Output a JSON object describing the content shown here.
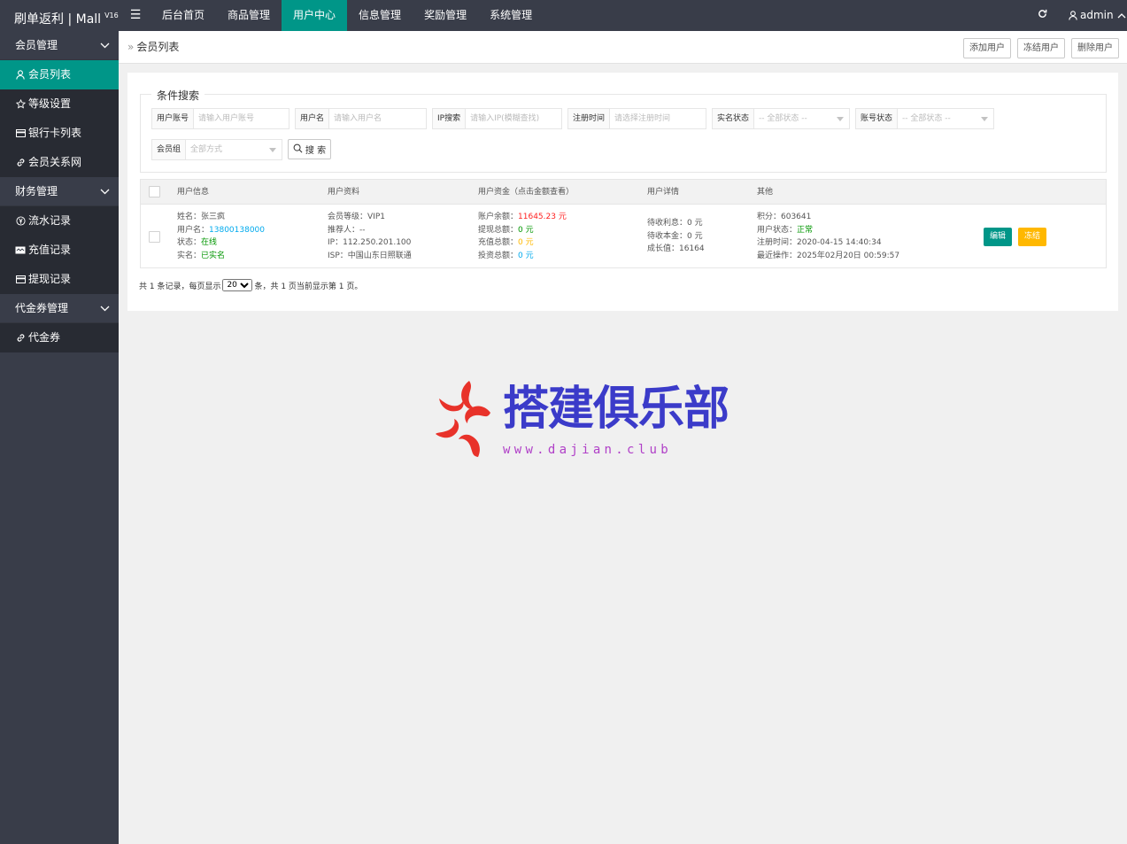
{
  "app": {
    "title": "刷单返利 | Mall",
    "version": "V16"
  },
  "header": {
    "menu_toggle": "☰",
    "nav": [
      "后台首页",
      "商品管理",
      "用户中心",
      "信息管理",
      "奖励管理",
      "系统管理"
    ],
    "active_nav": "用户中心",
    "user": "admin"
  },
  "sidebar": {
    "groups": [
      {
        "label": "会员管理",
        "items": [
          {
            "label": "会员列表",
            "icon": "user-icon"
          },
          {
            "label": "等级设置",
            "icon": "star-icon"
          },
          {
            "label": "银行卡列表",
            "icon": "card-icon"
          },
          {
            "label": "会员关系网",
            "icon": "link-icon"
          }
        ]
      },
      {
        "label": "财务管理",
        "items": [
          {
            "label": "流水记录",
            "icon": "yen-circle-icon"
          },
          {
            "label": "充值记录",
            "icon": "card-icon"
          },
          {
            "label": "提现记录",
            "icon": "card-icon"
          }
        ]
      },
      {
        "label": "代金券管理",
        "items": [
          {
            "label": "代金券",
            "icon": "link-icon"
          }
        ]
      }
    ],
    "active_item": "会员列表"
  },
  "breadcrumb": {
    "current": "会员列表"
  },
  "actions": {
    "add": "添加用户",
    "freeze": "冻结用户",
    "delete": "删除用户"
  },
  "search": {
    "legend": "条件搜索",
    "fields": [
      {
        "label": "用户账号",
        "placeholder": "请输入用户账号"
      },
      {
        "label": "用户名",
        "placeholder": "请输入用户名"
      },
      {
        "label": "IP搜索",
        "placeholder": "请输入IP(模糊查找)"
      },
      {
        "label": "注册时间",
        "placeholder": "请选择注册时间"
      },
      {
        "label": "实名状态",
        "placeholder": "-- 全部状态 --"
      },
      {
        "label": "账号状态",
        "placeholder": "-- 全部状态 --"
      },
      {
        "label": "会员组",
        "placeholder": "全部方式"
      }
    ],
    "button": "搜 索"
  },
  "table": {
    "headers": [
      "用户信息",
      "用户资料",
      "用户资金（点击金额查看）",
      "用户详情",
      "其他"
    ],
    "rows": [
      {
        "name_label": "姓名：",
        "name": "张三疯",
        "username_label": "用户名：",
        "username": "13800138000",
        "status_label": "状态：",
        "status": "在线",
        "realname_label": "实名：",
        "realname": "已实名",
        "level_label": "会员等级：",
        "level": "VIP1",
        "referrer_label": "推荐人：",
        "referrer": "--",
        "ip_label": "IP：",
        "ip": "112.250.201.100",
        "isp_label": "ISP：",
        "isp": "中国山东日照联通",
        "balance_label": "账户余额：",
        "balance": "11645.23 元",
        "withdraw_label": "提现总额：",
        "withdraw": "0 元",
        "recharge_label": "充值总额：",
        "recharge": "0 元",
        "invest_label": "投资总额：",
        "invest": "0 元",
        "pending_interest": "待收利息：0 元",
        "pending_principal": "待收本金：0 元",
        "growth": "成长值：16164",
        "points": "积分：603641",
        "user_state_label": "用户状态：",
        "user_state": "正常",
        "reg_time": "注册时间：2020-04-15 14:40:34",
        "last_op": "最近操作：2025年02月20日 00:59:57",
        "edit_btn": "编辑",
        "freeze_btn": "冻结"
      }
    ]
  },
  "pagination": {
    "prefix": "共 1 条记录，每页显示",
    "page_size": "20",
    "suffix": "条，共 1 页当前显示第 1 页。"
  },
  "watermark": {
    "title": "搭建俱乐部",
    "url": "www.dajian.club"
  },
  "colors": {
    "header_bg": "#393d49",
    "accent": "#009688",
    "warn": "#FFB800",
    "danger": "#FF5722"
  }
}
